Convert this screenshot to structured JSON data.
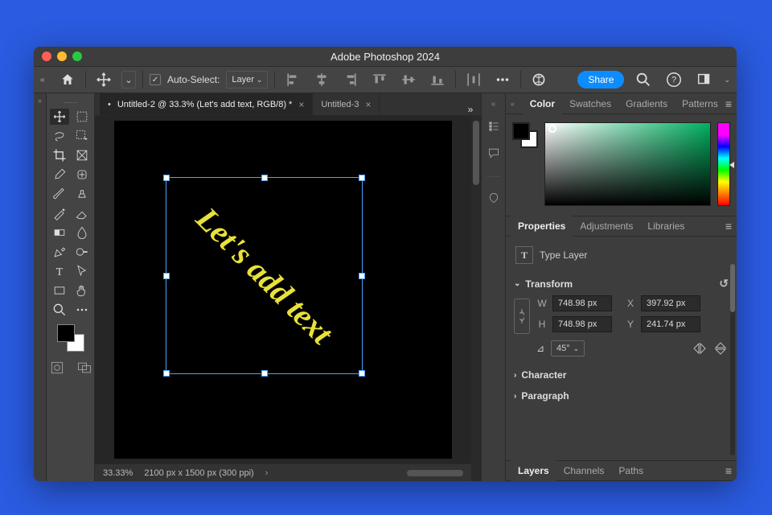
{
  "window": {
    "title": "Adobe Photoshop 2024"
  },
  "optbar": {
    "auto_select_label": "Auto-Select:",
    "auto_select_checked": true,
    "auto_select_target": "Layer",
    "share_label": "Share"
  },
  "tabs": {
    "items": [
      {
        "label": "Untitled-2 @ 33.3% (Let's add text, RGB/8) *",
        "active": true,
        "modified": true
      },
      {
        "label": "Untitled-3",
        "active": false,
        "modified": false
      }
    ]
  },
  "canvas": {
    "text": "Let's add text",
    "text_color": "#e8e139",
    "rotation_deg": 45
  },
  "statusbar": {
    "zoom": "33.33%",
    "doc_info": "2100 px x 1500 px (300 ppi)"
  },
  "right_panels": {
    "color_tabs": [
      "Color",
      "Swatches",
      "Gradients",
      "Patterns"
    ],
    "color_active": "Color",
    "fg": "#000000",
    "bg": "#ffffff",
    "prop_tabs": [
      "Properties",
      "Adjustments",
      "Libraries"
    ],
    "prop_active": "Properties",
    "type_layer_label": "Type Layer",
    "transform": {
      "label": "Transform",
      "W": "748.98 px",
      "H": "748.98 px",
      "X": "397.92 px",
      "Y": "241.74 px",
      "angle": "45°"
    },
    "character_label": "Character",
    "paragraph_label": "Paragraph",
    "bottom_tabs": [
      "Layers",
      "Channels",
      "Paths"
    ],
    "bottom_active": "Layers"
  }
}
